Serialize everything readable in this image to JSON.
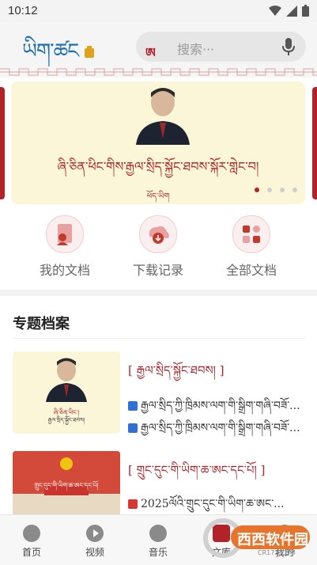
{
  "status_bar": {
    "time": "10:12"
  },
  "header": {
    "logo_text": "ཡིག་ཚང",
    "search": {
      "tag": "ཨ",
      "placeholder": "搜索···"
    }
  },
  "banner": {
    "title": "ཞི་ཅིན་ཕིང་གིས་རྒྱལ་སྲིད་སྐྱོང་ཐབས་སྐོར་གླེང་བ།",
    "subtitle": "ཕོད་ཡིག",
    "slide_count": 4,
    "active_slide": 1
  },
  "quick_actions": [
    {
      "label": "我的文档",
      "icon": "my-docs-icon"
    },
    {
      "label": "下载记录",
      "icon": "download-record-icon"
    },
    {
      "label": "全部文档",
      "icon": "all-docs-icon"
    }
  ],
  "section": {
    "title": "专题档案"
  },
  "cards": [
    {
      "title": "[ རྒྱལ་སྲིད་སྐྱོང་ཐབས། ]",
      "thumb_caption_1": "ཞི་ཅིན་ཕིང་།",
      "thumb_caption_2": "རྒྱལ་སྲིད་སྐྱོང་ཐབས།",
      "items": [
        {
          "type": "word",
          "text": "རྒྱལ་སྲིད་ཀྱི་ཁྲིམས་ལག་གི་སྒྲིག་གཞི་བཟོ་..."
        },
        {
          "type": "word",
          "text": "རྒྱལ་སྲིད་ཀྱི་ཁྲིམས་ལག་གི་སྒྲིག་གཞི་བཟོ་..."
        }
      ]
    },
    {
      "title": "[ གྲུང་དུང་གི་ཡིག་ཆ་ཨང་དང་པོ། ]",
      "thumb_caption_1": "གྲུང་དུང་གི་ཡིག་ཆ་ཨང་དང་པོ།",
      "items": [
        {
          "type": "pdf",
          "text": "2025ལོའི་གྲུང་དུང་གི་ཡིག་ཆ་ཨང་..."
        }
      ]
    }
  ],
  "tabbar": [
    {
      "label": "首页",
      "icon": "home-icon"
    },
    {
      "label": "视频",
      "icon": "video-icon"
    },
    {
      "label": "音乐",
      "icon": "music-icon"
    },
    {
      "label": "文库",
      "icon": "library-icon"
    },
    {
      "label": "我的",
      "icon": "profile-icon"
    }
  ],
  "watermark": {
    "text": "西西软件园",
    "sub": "CR173.COM"
  },
  "colors": {
    "accent": "#b32229",
    "brand_blue": "#1f6fb5",
    "banner_bg": "#fcf6d9"
  }
}
